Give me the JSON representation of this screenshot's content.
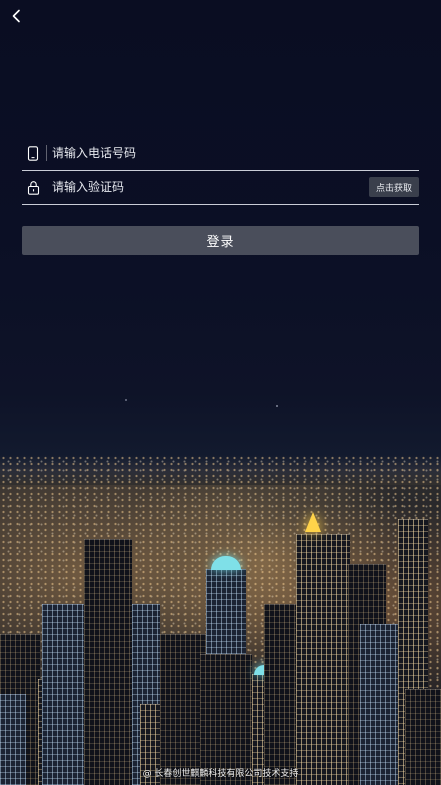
{
  "header": {
    "back_icon": "chevron-left-icon"
  },
  "form": {
    "phone": {
      "icon": "phone-icon",
      "placeholder": "请输入电话号码",
      "value": ""
    },
    "code": {
      "icon": "lock-icon",
      "placeholder": "请输入验证码",
      "value": "",
      "send_button_label": "点击获取"
    },
    "login_label": "登录"
  },
  "footer": {
    "text": "@ 长春创世麒麟科技有限公司技术支持"
  },
  "background": {
    "description_colors": {
      "sky": "#0a0d22",
      "button": "#4a4e5b",
      "code_button": "#3a3f4c"
    }
  }
}
